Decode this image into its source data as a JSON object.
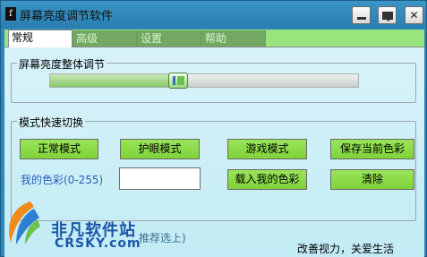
{
  "window": {
    "title": "屏幕亮度调节软件",
    "icon_glyph": "f"
  },
  "tabs": [
    {
      "label": "常规",
      "active": true
    },
    {
      "label": "高级",
      "active": false
    },
    {
      "label": "设置",
      "active": false
    },
    {
      "label": "帮助",
      "active": false
    }
  ],
  "brightness": {
    "group_label": "屏幕亮度整体调节",
    "level": 0.41
  },
  "modes": {
    "group_label": "模式快速切换",
    "normal": "正常模式",
    "eye_care": "护眼模式",
    "game": "游戏模式",
    "save_color": "保存当前色彩",
    "my_color_label": "我的色彩(0-255)",
    "my_color_value": "",
    "load_color": "载入我的色彩",
    "clear": "清除"
  },
  "footer": {
    "hint_fragment": "推荐选上)",
    "slogan": "改善视力，关爱生活"
  },
  "watermark": {
    "name": "非凡软件站",
    "domain": "CRSKY.com"
  },
  "colors": {
    "title_bar": "#2f86b8",
    "tab_strip": "#98e57e",
    "button_green": "#8cdc48",
    "panel_bg": "#cfeef7"
  }
}
